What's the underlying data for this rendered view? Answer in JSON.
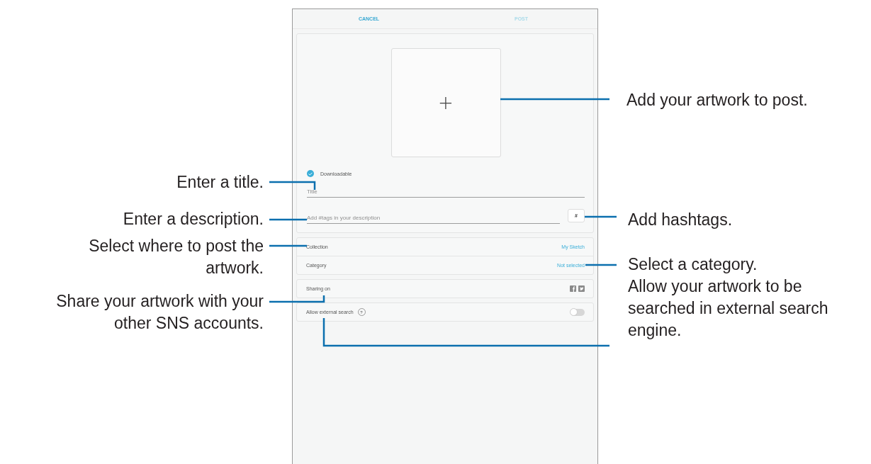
{
  "header": {
    "buttons": [
      {
        "label": "CANCEL",
        "disabled": false
      },
      {
        "label": "POST",
        "disabled": true
      }
    ]
  },
  "artwork_picker": {
    "icon": "+"
  },
  "downloadable": {
    "label": "Downloadable",
    "checked": true
  },
  "title_field": {
    "placeholder": "Title"
  },
  "description_field": {
    "placeholder": "Add #tags in your description"
  },
  "hashtag_button": "#",
  "settings": [
    {
      "label": "Collection",
      "value": "My Sketch"
    },
    {
      "label": "Category",
      "value": "Not selected"
    }
  ],
  "sharing": {
    "label": "Sharing on"
  },
  "external_search": {
    "label": "Allow external search",
    "help": "?",
    "on": false
  },
  "callouts": [
    {
      "lines": [
        "Add your artwork to post."
      ]
    },
    {
      "lines": [
        "Enter a title."
      ]
    },
    {
      "lines": [
        "Enter a description."
      ]
    },
    {
      "lines": [
        "Select where to post the",
        "artwork."
      ]
    },
    {
      "lines": [
        "Share your artwork with your",
        "other SNS accounts."
      ]
    },
    {
      "lines": [
        "Add hashtags."
      ]
    },
    {
      "lines": [
        "Select a category."
      ]
    },
    {
      "lines": [
        "Allow your artwork to be",
        "searched in external search",
        "engine."
      ]
    }
  ]
}
